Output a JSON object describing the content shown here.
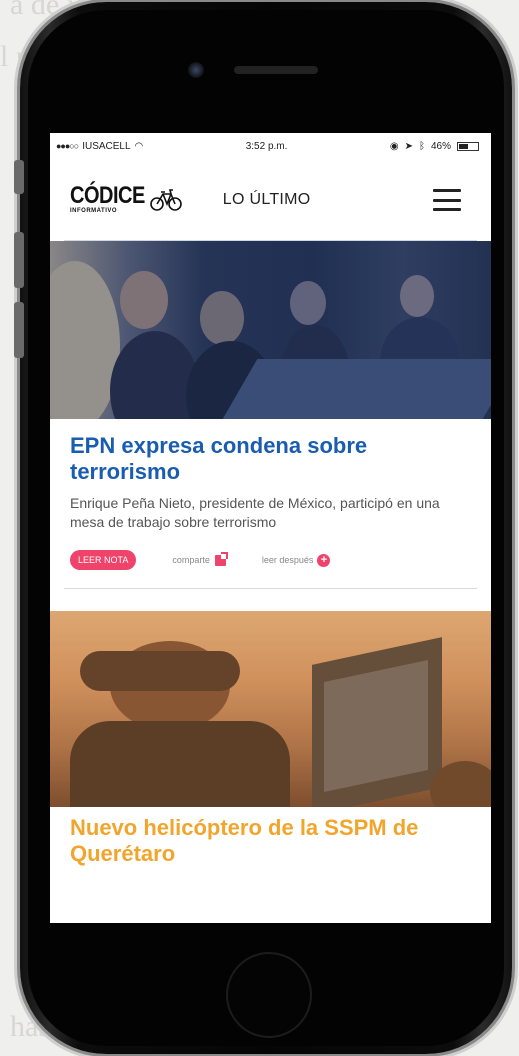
{
  "status_bar": {
    "carrier": "IUSACELL",
    "time": "3:52 p.m.",
    "battery": "46%"
  },
  "header": {
    "logo_main": "CÓDICE",
    "logo_sub": "INFORMATIVO",
    "section_title": "LO ÚLTIMO"
  },
  "articles": [
    {
      "title": "EPN expresa condena sobre terrorismo",
      "summary": "Enrique Peña Nieto, presidente de México, participó en una mesa de trabajo sobre terrorismo",
      "read_label": "LEER NOTA",
      "share_label": "comparte",
      "later_label": "leer después"
    },
    {
      "title": "Nuevo helicóptero de la SSPM de Querétaro"
    }
  ],
  "colors": {
    "title_blue": "#1a5db0",
    "title_orange": "#f2a52d",
    "accent_pink": "#f0436b"
  }
}
